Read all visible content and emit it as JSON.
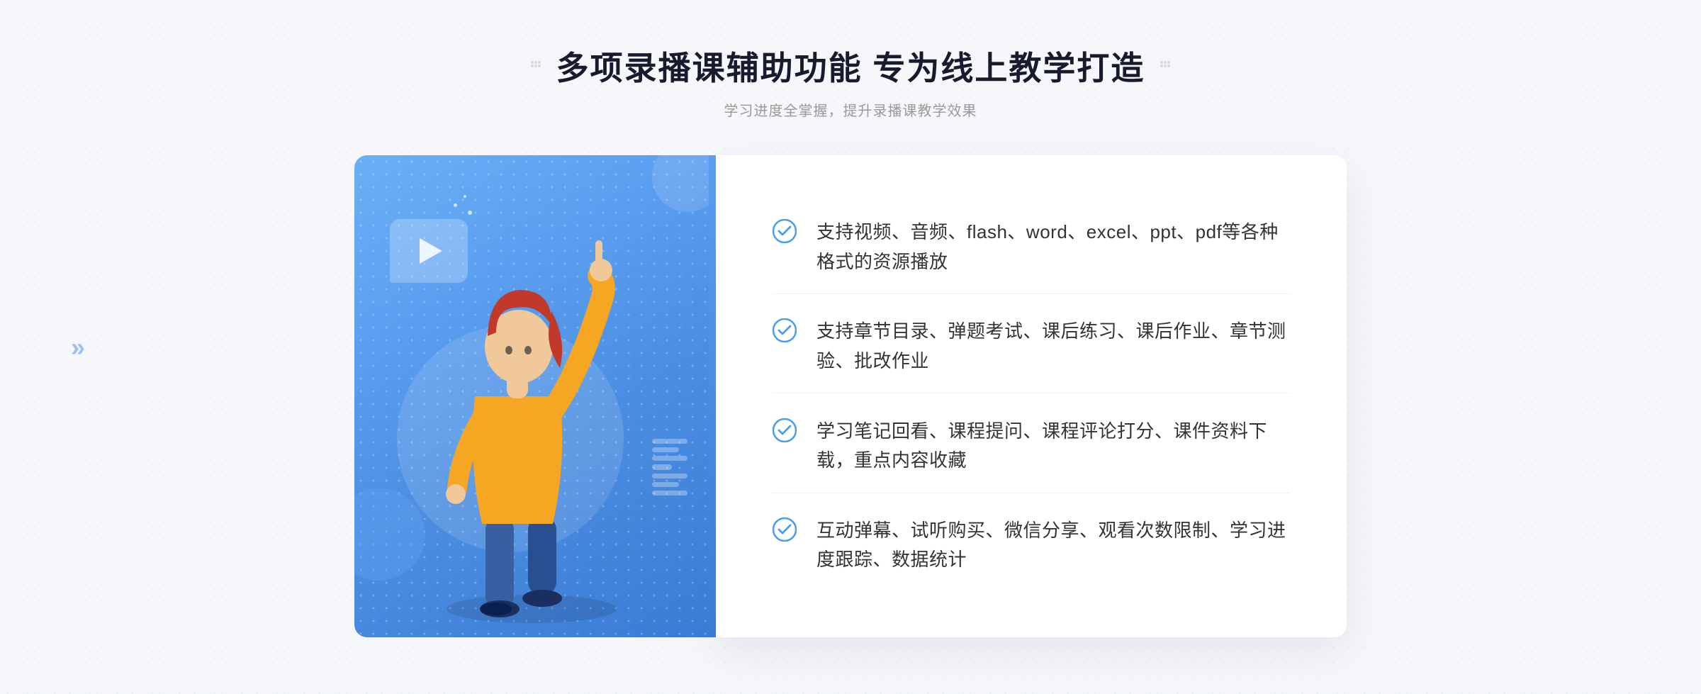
{
  "header": {
    "title": "多项录播课辅助功能 专为线上教学打造",
    "subtitle": "学习进度全掌握，提升录播课教学效果",
    "deco_dots": "⁞⁞"
  },
  "features": [
    {
      "id": 1,
      "text": "支持视频、音频、flash、word、excel、ppt、pdf等各种格式的资源播放"
    },
    {
      "id": 2,
      "text": "支持章节目录、弹题考试、课后练习、课后作业、章节测验、批改作业"
    },
    {
      "id": 3,
      "text": "学习笔记回看、课程提问、课程评论打分、课件资料下载，重点内容收藏"
    },
    {
      "id": 4,
      "text": "互动弹幕、试听购买、微信分享、观看次数限制、学习进度跟踪、数据统计"
    }
  ],
  "colors": {
    "blue_primary": "#4a8de0",
    "blue_light": "#6ab0f5",
    "blue_dark": "#3a7bd5",
    "text_dark": "#1a1a2e",
    "text_medium": "#333333",
    "text_light": "#999999",
    "bg": "#f5f7fa",
    "white": "#ffffff",
    "check_color": "#4a9ef0"
  }
}
